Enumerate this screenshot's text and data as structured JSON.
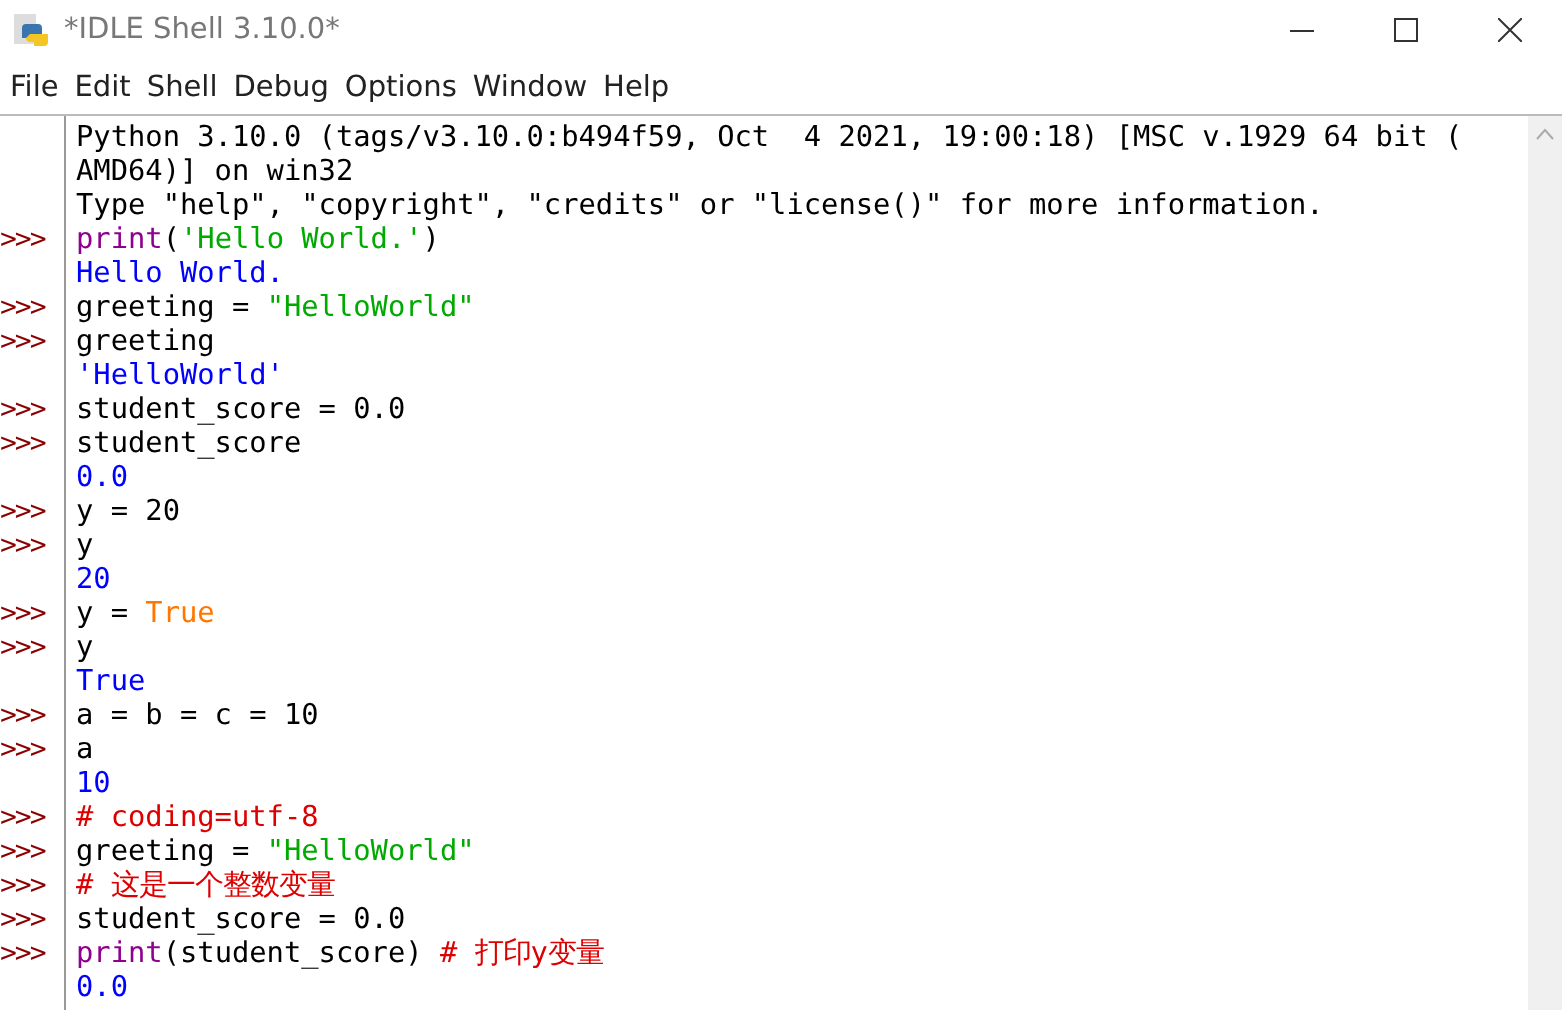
{
  "window": {
    "title": "*IDLE Shell 3.10.0*"
  },
  "menu": [
    "File",
    "Edit",
    "Shell",
    "Debug",
    "Options",
    "Window",
    "Help"
  ],
  "shell": {
    "lines": [
      {
        "segments": [
          {
            "kind": "plain",
            "text": "Python 3.10.0 (tags/v3.10.0:b494f59, Oct  4 2021, 19:00:18) [MSC v.1929 64 bit ("
          }
        ]
      },
      {
        "segments": [
          {
            "kind": "plain",
            "text": "AMD64)] on win32"
          }
        ]
      },
      {
        "segments": [
          {
            "kind": "plain",
            "text": "Type \"help\", \"copyright\", \"credits\" or \"license()\" for more information."
          }
        ]
      },
      {
        "prompt": ">>>",
        "segments": [
          {
            "kind": "builtin",
            "text": "print"
          },
          {
            "kind": "plain",
            "text": "("
          },
          {
            "kind": "string",
            "text": "'Hello World.'"
          },
          {
            "kind": "plain",
            "text": ")"
          }
        ]
      },
      {
        "segments": [
          {
            "kind": "output",
            "text": "Hello World."
          }
        ]
      },
      {
        "prompt": ">>>",
        "segments": [
          {
            "kind": "plain",
            "text": "greeting = "
          },
          {
            "kind": "string",
            "text": "\"HelloWorld\""
          }
        ]
      },
      {
        "prompt": ">>>",
        "segments": [
          {
            "kind": "plain",
            "text": "greeting"
          }
        ]
      },
      {
        "segments": [
          {
            "kind": "output",
            "text": "'HelloWorld'"
          }
        ]
      },
      {
        "prompt": ">>>",
        "segments": [
          {
            "kind": "plain",
            "text": "student_score = 0.0"
          }
        ]
      },
      {
        "prompt": ">>>",
        "segments": [
          {
            "kind": "plain",
            "text": "student_score"
          }
        ]
      },
      {
        "segments": [
          {
            "kind": "output",
            "text": "0.0"
          }
        ]
      },
      {
        "prompt": ">>>",
        "segments": [
          {
            "kind": "plain",
            "text": "y = 20"
          }
        ]
      },
      {
        "prompt": ">>>",
        "segments": [
          {
            "kind": "plain",
            "text": "y"
          }
        ]
      },
      {
        "segments": [
          {
            "kind": "output",
            "text": "20"
          }
        ]
      },
      {
        "prompt": ">>>",
        "segments": [
          {
            "kind": "plain",
            "text": "y = "
          },
          {
            "kind": "keyword",
            "text": "True"
          }
        ]
      },
      {
        "prompt": ">>>",
        "segments": [
          {
            "kind": "plain",
            "text": "y"
          }
        ]
      },
      {
        "segments": [
          {
            "kind": "output",
            "text": "True"
          }
        ]
      },
      {
        "prompt": ">>>",
        "segments": [
          {
            "kind": "plain",
            "text": "a = b = c = 10"
          }
        ]
      },
      {
        "prompt": ">>>",
        "segments": [
          {
            "kind": "plain",
            "text": "a"
          }
        ]
      },
      {
        "segments": [
          {
            "kind": "output",
            "text": "10"
          }
        ]
      },
      {
        "prompt": ">>>",
        "segments": [
          {
            "kind": "comment",
            "text": "# coding=utf-8"
          }
        ]
      },
      {
        "prompt": ">>>",
        "segments": [
          {
            "kind": "plain",
            "text": "greeting = "
          },
          {
            "kind": "string",
            "text": "\"HelloWorld\""
          }
        ]
      },
      {
        "prompt": ">>>",
        "segments": [
          {
            "kind": "comment",
            "text": "# 这是一个整数变量"
          }
        ]
      },
      {
        "prompt": ">>>",
        "segments": [
          {
            "kind": "plain",
            "text": "student_score = 0.0"
          }
        ]
      },
      {
        "prompt": ">>>",
        "segments": [
          {
            "kind": "builtin",
            "text": "print"
          },
          {
            "kind": "plain",
            "text": "(student_score) "
          },
          {
            "kind": "comment",
            "text": "# 打印y变量"
          }
        ]
      },
      {
        "segments": [
          {
            "kind": "output",
            "text": "0.0"
          }
        ]
      }
    ]
  }
}
